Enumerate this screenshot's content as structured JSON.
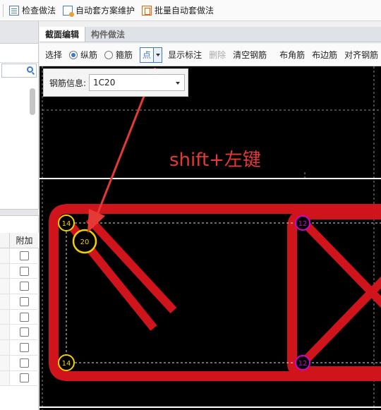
{
  "toolbar": {
    "check_label": "检查做法",
    "auto_scheme_label": "自动套方案维护",
    "batch_label": "批量自动套做法"
  },
  "left_panel": {
    "column_header": "附加",
    "checkbox_rows": 9
  },
  "tabs": [
    {
      "label": "截面编辑",
      "active": true
    },
    {
      "label": "构件做法",
      "active": false
    }
  ],
  "tools": {
    "select": "选择",
    "longitudinal": "纵筋",
    "stirrup": "箍筋",
    "mode_value": "点",
    "show_label": "显示标注",
    "delete": "删除",
    "clear": "清空钢筋",
    "corner": "布角筋",
    "edge": "布边筋",
    "align": "对齐钢筋"
  },
  "rebar_info": {
    "label": "钢筋信息:",
    "value": "1C20"
  },
  "annotation": {
    "text": "shift+左键",
    "color": "#e53935"
  },
  "bar_markers": {
    "top_left": "14",
    "placed": "20",
    "bottom_left": "14",
    "right_top": "12",
    "right_bottom": "12"
  },
  "colors": {
    "stirrup": "#d0141c",
    "marker_yellow": "#f2d000",
    "marker_magenta": "#d200d2",
    "accent": "#3a79c9"
  }
}
